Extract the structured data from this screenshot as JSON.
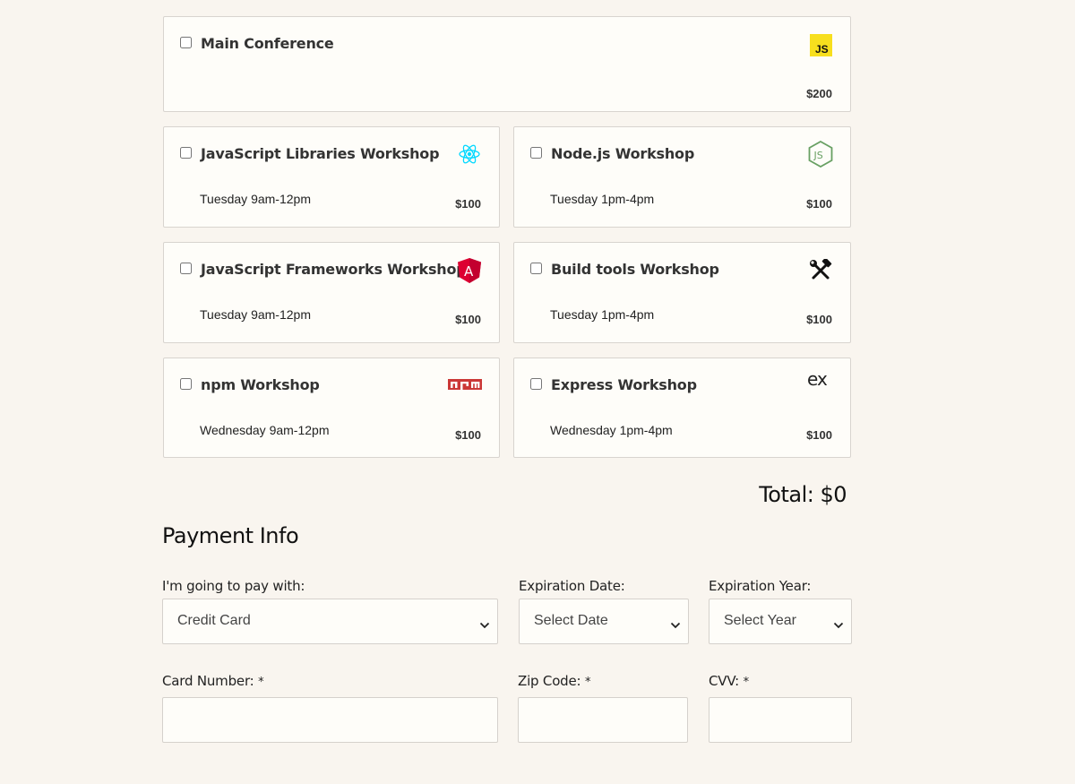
{
  "workshops": [
    {
      "title": "Main Conference",
      "time": "",
      "price": "$200",
      "icon": "javascript-icon"
    },
    {
      "title": "JavaScript Libraries Workshop",
      "time": "Tuesday 9am-12pm",
      "price": "$100",
      "icon": "react-icon"
    },
    {
      "title": "Node.js Workshop",
      "time": "Tuesday 1pm-4pm",
      "price": "$100",
      "icon": "nodejs-icon"
    },
    {
      "title": "JavaScript Frameworks Workshop",
      "time": "Tuesday 9am-12pm",
      "price": "$100",
      "icon": "angular-icon"
    },
    {
      "title": "Build tools Workshop",
      "time": "Tuesday 1pm-4pm",
      "price": "$100",
      "icon": "tools-icon"
    },
    {
      "title": "npm Workshop",
      "time": "Wednesday 9am-12pm",
      "price": "$100",
      "icon": "npm-icon"
    },
    {
      "title": "Express Workshop",
      "time": "Wednesday 1pm-4pm",
      "price": "$100",
      "icon": "express-icon"
    }
  ],
  "total": "Total: $0",
  "payment": {
    "title": "Payment Info",
    "pay_with_label": "I'm going to pay with:",
    "pay_with_value": "Credit Card",
    "exp_date_label": "Expiration Date:",
    "exp_date_value": "Select Date",
    "exp_year_label": "Expiration Year:",
    "exp_year_value": "Select Year",
    "card_number_label": "Card Number:",
    "zip_label": "Zip Code:",
    "cvv_label": "CVV:",
    "required_marker": "*",
    "card_number_value": "",
    "zip_value": "",
    "cvv_value": ""
  },
  "colors": {
    "background": "#f9f5ef",
    "card": "#fefdf9",
    "js_yellow": "#f7df1e",
    "react_cyan": "#00d8ff",
    "node_green": "#68a063",
    "angular_red": "#dd0031",
    "npm_red": "#cb3837"
  }
}
